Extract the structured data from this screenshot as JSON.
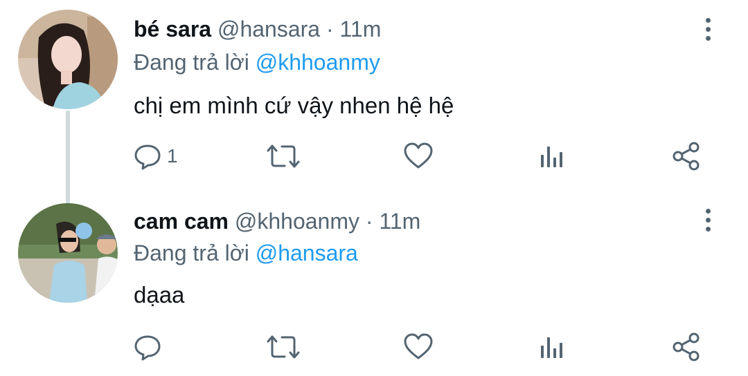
{
  "tweets": [
    {
      "display_name": "bé sara",
      "handle": "@hansara",
      "separator": "·",
      "time": "11m",
      "reply_prefix": "Đang trả lời",
      "reply_to": "@khhoanmy",
      "text": "chị em mình cứ vậy nhen hệ hệ",
      "reply_count": "1",
      "retweet_count": "",
      "like_count": ""
    },
    {
      "display_name": "cam cam",
      "handle": "@khhoanmy",
      "separator": "·",
      "time": "11m",
      "reply_prefix": "Đang trả lời",
      "reply_to": "@hansara",
      "text": "dạaa",
      "reply_count": "",
      "retweet_count": "",
      "like_count": ""
    }
  ],
  "icons": {
    "reply": "comment-bubble-icon",
    "retweet": "retweet-arrows-icon",
    "like": "heart-outline-icon",
    "views": "bar-chart-icon",
    "share": "share-nodes-icon",
    "more": "vertical-ellipsis-icon"
  },
  "colors": {
    "text": "#0f1419",
    "secondary": "#536471",
    "link": "#1d9bf0",
    "thread_line": "#cfd9de"
  }
}
